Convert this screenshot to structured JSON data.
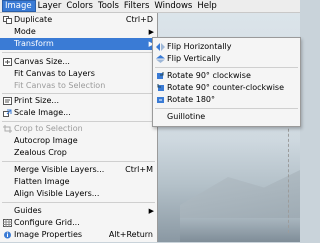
{
  "menubar": [
    {
      "label": "Image",
      "active": true
    },
    {
      "label": "Layer"
    },
    {
      "label": "Colors"
    },
    {
      "label": "Tools"
    },
    {
      "label": "Filters"
    },
    {
      "label": "Windows"
    },
    {
      "label": "Help"
    }
  ],
  "image_menu": {
    "items": [
      {
        "label": "Duplicate",
        "shortcut": "Ctrl+D",
        "icon": "duplicate-icon"
      },
      {
        "label": "Mode",
        "submenu": true
      },
      {
        "label": "Transform",
        "submenu": true,
        "highlighted": true
      },
      {
        "label": "Canvas Size...",
        "icon": "canvas-size-icon"
      },
      {
        "label": "Fit Canvas to Layers"
      },
      {
        "label": "Fit Canvas to Selection",
        "disabled": true
      },
      {
        "label": "Print Size...",
        "icon": "print-size-icon"
      },
      {
        "label": "Scale Image...",
        "icon": "scale-image-icon"
      },
      {
        "label": "Crop to Selection",
        "disabled": true,
        "icon": "crop-icon"
      },
      {
        "label": "Autocrop Image"
      },
      {
        "label": "Zealous Crop"
      },
      {
        "label": "Merge Visible Layers...",
        "shortcut": "Ctrl+M"
      },
      {
        "label": "Flatten Image"
      },
      {
        "label": "Align Visible Layers..."
      },
      {
        "label": "Guides",
        "submenu": true
      },
      {
        "label": "Configure Grid...",
        "icon": "grid-icon"
      },
      {
        "label": "Image Properties",
        "shortcut": "Alt+Return",
        "icon": "info-icon"
      }
    ]
  },
  "transform_submenu": {
    "items": [
      {
        "label": "Flip Horizontally",
        "icon": "flip-horizontal-icon"
      },
      {
        "label": "Flip Vertically",
        "icon": "flip-vertical-icon"
      },
      {
        "label": "Rotate 90° clockwise",
        "icon": "rotate-cw-icon"
      },
      {
        "label": "Rotate 90° counter-clockwise",
        "icon": "rotate-ccw-icon"
      },
      {
        "label": "Rotate 180°",
        "icon": "rotate-180-icon"
      },
      {
        "label": "Guillotine"
      }
    ]
  }
}
